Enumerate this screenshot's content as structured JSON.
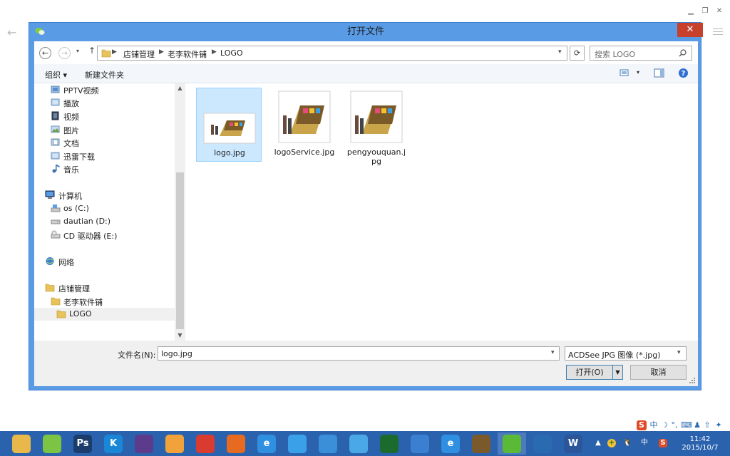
{
  "dialog": {
    "title": "打开文件",
    "close_glyph": "✕"
  },
  "address": {
    "crumbs": [
      "店铺管理",
      "老李软件铺",
      "LOGO"
    ],
    "separator": "▶"
  },
  "search": {
    "placeholder": "搜索 LOGO"
  },
  "toolbar": {
    "organize": "组织 ▾",
    "new_folder": "新建文件夹"
  },
  "nav": {
    "items": [
      {
        "label": "PPTV视频",
        "icon": "video-library-icon"
      },
      {
        "label": "播放",
        "icon": "library-icon"
      },
      {
        "label": "视频",
        "icon": "video-library-icon"
      },
      {
        "label": "图片",
        "icon": "pictures-library-icon"
      },
      {
        "label": "文档",
        "icon": "documents-library-icon"
      },
      {
        "label": "迅雷下载",
        "icon": "download-library-icon"
      },
      {
        "label": "音乐",
        "icon": "music-library-icon"
      }
    ],
    "computer": {
      "label": "计算机",
      "icon": "computer-icon"
    },
    "drives": [
      {
        "label": "os (C:)",
        "icon": "system-drive-icon"
      },
      {
        "label": "dautian (D:)",
        "icon": "drive-icon"
      },
      {
        "label": "CD 驱动器 (E:)",
        "icon": "cd-drive-icon"
      }
    ],
    "network": {
      "label": "网络",
      "icon": "network-icon"
    },
    "folders": [
      {
        "label": "店铺管理",
        "icon": "folder-icon"
      },
      {
        "label": "老李软件铺",
        "icon": "folder-icon"
      },
      {
        "label": "LOGO",
        "icon": "folder-icon"
      }
    ]
  },
  "files": [
    {
      "name": "logo.jpg",
      "selected": true
    },
    {
      "name": "logoService.jpg",
      "selected": false
    },
    {
      "name": "pengyouquan.jpg",
      "selected": false
    }
  ],
  "bottom": {
    "filename_label": "文件名(N):",
    "filename_value": "logo.jpg",
    "filetype_value": "ACDSee JPG 图像 (*.jpg)",
    "open_label": "打开(O)",
    "cancel_label": "取消"
  },
  "taskbar": {
    "apps": [
      {
        "name": "file-explorer-icon",
        "color": "#e8b84a"
      },
      {
        "name": "360-browser-icon",
        "color": "#7cc443"
      },
      {
        "name": "photoshop-icon",
        "color": "#1b3d6b",
        "text": "Ps"
      },
      {
        "name": "kugou-icon",
        "color": "#1a86d6",
        "text": "K"
      },
      {
        "name": "eclipse-icon",
        "color": "#5c3a8c"
      },
      {
        "name": "360-safe-icon",
        "color": "#f2a23a"
      },
      {
        "name": "chrome-icon",
        "color": "#d93b30"
      },
      {
        "name": "firefox-icon",
        "color": "#e66a1f"
      },
      {
        "name": "ie-icon",
        "color": "#2f8fe0",
        "text": "e"
      },
      {
        "name": "xunlei-icon",
        "color": "#3aa0e8"
      },
      {
        "name": "baidu-cloud-icon",
        "color": "#3a8fd8"
      },
      {
        "name": "qq-cloud-icon",
        "color": "#4aa8e8"
      },
      {
        "name": "eye-app-icon",
        "color": "#1b6b2e"
      },
      {
        "name": "pen-app-icon",
        "color": "#3a7fd0"
      },
      {
        "name": "ie-blue-icon",
        "color": "#2f8fe0",
        "text": "e"
      },
      {
        "name": "game-app-icon",
        "color": "#7a5a2a"
      },
      {
        "name": "wechat-icon",
        "color": "#5ab936"
      },
      {
        "name": "remote-desktop-icon",
        "color": "#2a6ab0"
      },
      {
        "name": "word-icon",
        "color": "#2b579a",
        "text": "W"
      }
    ],
    "time": "11:42",
    "date": "2015/10/7",
    "tray_input": "中"
  },
  "ime": {
    "mode": "中"
  }
}
